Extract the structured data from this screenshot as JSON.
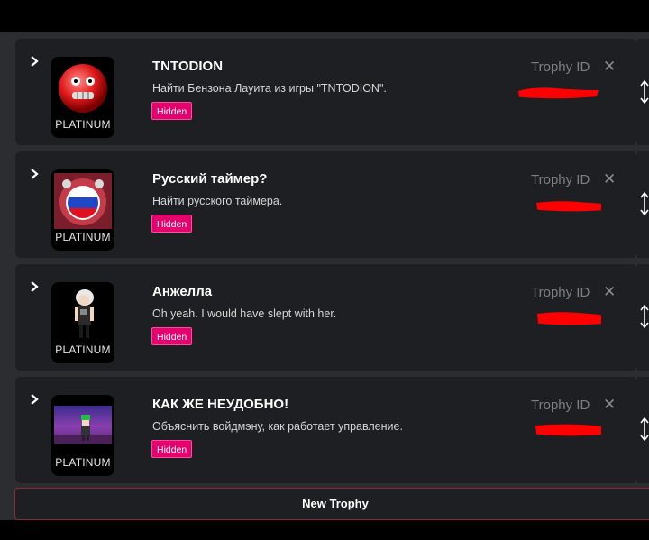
{
  "trophies": [
    {
      "title": "TNTODION",
      "description": "Найти Бензона Лауита из игры \"TNTODION\".",
      "badge": "Hidden",
      "tier": "PLATINUM",
      "id_placeholder": "Trophy ID",
      "image": "red-ball-face"
    },
    {
      "title": "Русский таймер?",
      "description": "Найти русского таймера.",
      "badge": "Hidden",
      "tier": "PLATINUM",
      "id_placeholder": "Trophy ID",
      "image": "russian-timer"
    },
    {
      "title": "Анжелла",
      "description": "Oh yeah. I would have slept with her.",
      "badge": "Hidden",
      "tier": "PLATINUM",
      "id_placeholder": "Trophy ID",
      "image": "character-figure"
    },
    {
      "title": "КАК ЖЕ НЕУДОБНО!",
      "description": "Объяснить войдмэну, как работает управление.",
      "badge": "Hidden",
      "tier": "PLATINUM",
      "id_placeholder": "Trophy ID",
      "image": "pixel-scene"
    }
  ],
  "new_trophy_label": "New Trophy",
  "icons": {
    "expand": "chevron-right-icon",
    "close": "close-icon",
    "reorder": "resize-vertical-icon"
  },
  "colors": {
    "hidden_badge": "#e6006e",
    "card_bg": "#1e1f22",
    "panel_bg": "#2b2d31",
    "redaction": "#ff0000"
  }
}
